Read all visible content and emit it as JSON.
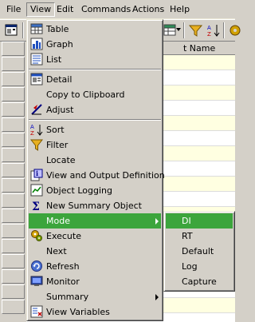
{
  "menubar": {
    "items": [
      "File",
      "View",
      "Edit",
      "Commands",
      "Actions",
      "Help"
    ]
  },
  "table": {
    "visible_header": "t Name"
  },
  "view_menu": {
    "items": [
      {
        "label": "Table",
        "icon": "table-icon"
      },
      {
        "label": "Graph",
        "icon": "graph-icon"
      },
      {
        "label": "List",
        "icon": "list-icon"
      },
      {
        "label": "Detail",
        "icon": "detail-icon"
      },
      {
        "label": "Copy to Clipboard",
        "icon": ""
      },
      {
        "label": "Adjust",
        "icon": "adjust-icon"
      },
      {
        "label": "Sort",
        "icon": "sort-icon"
      },
      {
        "label": "Filter",
        "icon": "filter-icon"
      },
      {
        "label": "Locate",
        "icon": ""
      },
      {
        "label": "View and Output Definition",
        "icon": "definition-icon"
      },
      {
        "label": "Object Logging",
        "icon": "logging-icon"
      },
      {
        "label": "New Summary Object",
        "icon": "sigma-icon"
      },
      {
        "label": "Mode",
        "icon": "",
        "highlighted": true,
        "submenu": true
      },
      {
        "label": "Execute",
        "icon": "execute-icon"
      },
      {
        "label": "Next",
        "icon": ""
      },
      {
        "label": "Refresh",
        "icon": "refresh-icon"
      },
      {
        "label": "Monitor",
        "icon": "monitor-icon"
      },
      {
        "label": "Summary",
        "icon": "",
        "submenu": true
      },
      {
        "label": "View Variables",
        "icon": "variables-icon"
      }
    ]
  },
  "mode_submenu": {
    "items": [
      "DI",
      "RT",
      "Default",
      "Log",
      "Capture"
    ],
    "highlighted": "DI"
  },
  "colors": {
    "highlight": "#3ca53c",
    "chrome": "#d4d0c8",
    "alt_row": "#ffffe1"
  }
}
